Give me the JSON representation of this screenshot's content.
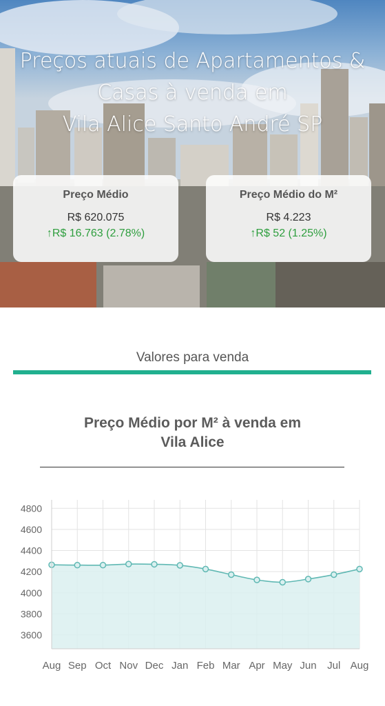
{
  "hero": {
    "title_lines": [
      "Preços atuais de Apartamentos &",
      "Casas à venda em",
      "Vila Alice Santo André SP"
    ]
  },
  "stats": [
    {
      "label": "Preço Médio",
      "value": "R$ 620.075",
      "change": "R$ 16.763 (2.78%)",
      "arrow": "↑"
    },
    {
      "label": "Preço Médio do M²",
      "value": "R$ 4.223",
      "change": "R$ 52 (1.25%)",
      "arrow": "↑"
    }
  ],
  "section": {
    "tab_label": "Valores para venda"
  },
  "chart_title_lines": [
    "Preço Médio por M² à venda em",
    "Vila Alice"
  ],
  "colors": {
    "accent": "#21b08f",
    "positive": "#2e9e3e",
    "series_line": "#5fb8b3",
    "series_fill": "#daf0f0"
  },
  "chart_data": {
    "type": "area",
    "title": "Preço Médio por M² à venda em Vila Alice",
    "categories": [
      "Aug",
      "Sep",
      "Oct",
      "Nov",
      "Dec",
      "Jan",
      "Feb",
      "Mar",
      "Apr",
      "May",
      "Jun",
      "Jul",
      "Aug"
    ],
    "series": [
      {
        "values": [
          4265,
          4262,
          4262,
          4272,
          4270,
          4260,
          4225,
          4172,
          4122,
          4100,
          4130,
          4172,
          4225
        ]
      }
    ],
    "yticks": [
      3600,
      3800,
      4000,
      4200,
      4400,
      4600,
      4800
    ],
    "ylim": [
      3470,
      4880
    ],
    "grid": true,
    "legend": "none"
  }
}
